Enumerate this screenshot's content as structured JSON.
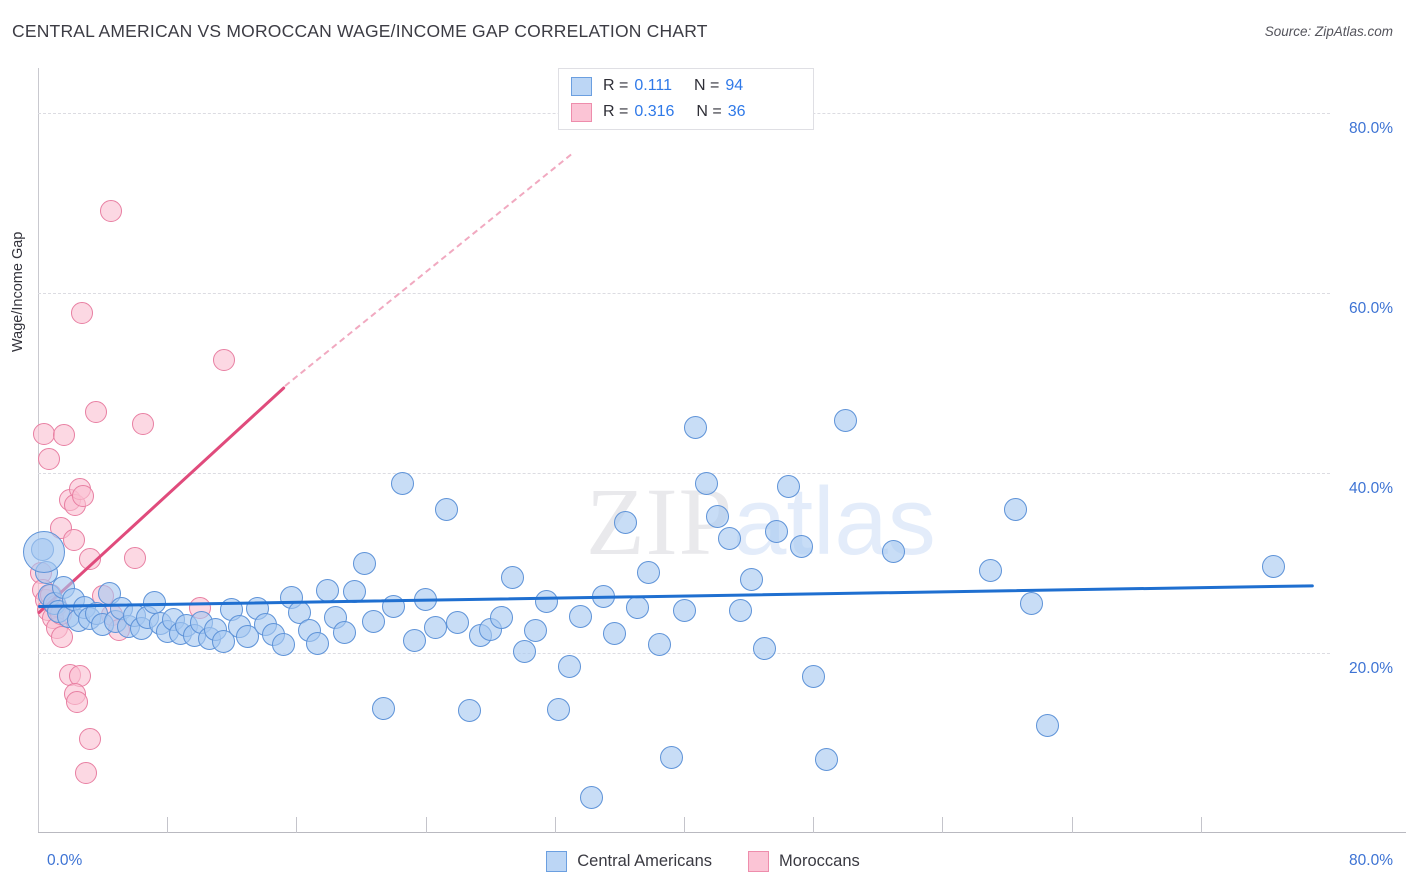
{
  "header": {
    "title": "CENTRAL AMERICAN VS MOROCCAN WAGE/INCOME GAP CORRELATION CHART",
    "source": "Source: ZipAtlas.com"
  },
  "watermark": {
    "part1": "ZIP",
    "part2": "atlas"
  },
  "stats": {
    "rows": [
      {
        "series": "Central Americans",
        "r_label": "R =",
        "r_value": "0.111",
        "n_label": "N =",
        "n_value": "94",
        "color": "#bcd6f5"
      },
      {
        "series": "Moroccans",
        "r_label": "R =",
        "r_value": "0.316",
        "n_label": "N =",
        "n_value": "36",
        "color": "#fbc4d5"
      }
    ]
  },
  "legend": {
    "items": [
      {
        "label": "Central Americans",
        "color": "#bcd6f5"
      },
      {
        "label": "Moroccans",
        "color": "#fbc4d5"
      }
    ]
  },
  "axes": {
    "y_title": "Wage/Income Gap",
    "y_ticks": [
      "80.0%",
      "60.0%",
      "40.0%",
      "20.0%"
    ],
    "x_min_label": "0.0%",
    "x_max_label": "80.0%"
  },
  "chart_data": {
    "type": "scatter",
    "title": "CENTRAL AMERICAN VS MOROCCAN WAGE/INCOME GAP CORRELATION CHART",
    "xlabel": "",
    "ylabel": "Wage/Income Gap",
    "xlim": [
      0,
      80
    ],
    "ylim": [
      0,
      85
    ],
    "x_unit": "%",
    "y_unit": "%",
    "grid": true,
    "y_gridlines": [
      20,
      40,
      60,
      80
    ],
    "legend_position": "bottom-center",
    "series": [
      {
        "name": "Central Americans",
        "color": "#a7c8f0",
        "border_color": "#5e93d8",
        "r": 0.111,
        "n": 94,
        "trendline": {
          "style": "solid",
          "x0": 0.0,
          "y0": 25.3,
          "x1": 79.0,
          "y1": 27.6
        },
        "points": [
          [
            0.3,
            31.5
          ],
          [
            0.5,
            29.0
          ],
          [
            0.7,
            26.4
          ],
          [
            1.0,
            25.5
          ],
          [
            1.3,
            24.6
          ],
          [
            1.6,
            27.3
          ],
          [
            1.9,
            24.1
          ],
          [
            2.2,
            26.0
          ],
          [
            2.5,
            23.6
          ],
          [
            2.9,
            25.1
          ],
          [
            3.2,
            23.8
          ],
          [
            3.6,
            24.4
          ],
          [
            4.0,
            23.2
          ],
          [
            4.4,
            26.6
          ],
          [
            4.8,
            23.5
          ],
          [
            5.2,
            24.9
          ],
          [
            5.6,
            23.0
          ],
          [
            6.0,
            24.2
          ],
          [
            6.4,
            22.7
          ],
          [
            6.8,
            23.9
          ],
          [
            7.2,
            25.6
          ],
          [
            7.6,
            23.3
          ],
          [
            8.0,
            22.4
          ],
          [
            8.4,
            23.7
          ],
          [
            8.8,
            22.2
          ],
          [
            9.2,
            23.1
          ],
          [
            9.7,
            22.0
          ],
          [
            10.1,
            23.4
          ],
          [
            10.6,
            21.6
          ],
          [
            11.0,
            22.6
          ],
          [
            11.5,
            21.3
          ],
          [
            12.0,
            24.8
          ],
          [
            12.5,
            22.9
          ],
          [
            13.0,
            21.8
          ],
          [
            13.6,
            25.0
          ],
          [
            14.1,
            23.2
          ],
          [
            14.6,
            22.1
          ],
          [
            15.2,
            21.0
          ],
          [
            15.7,
            26.2
          ],
          [
            16.2,
            24.5
          ],
          [
            16.8,
            22.5
          ],
          [
            17.3,
            21.1
          ],
          [
            17.9,
            27.0
          ],
          [
            18.4,
            24.0
          ],
          [
            19.0,
            22.3
          ],
          [
            19.6,
            26.8
          ],
          [
            20.2,
            30.0
          ],
          [
            20.8,
            23.5
          ],
          [
            21.4,
            13.8
          ],
          [
            22.0,
            25.2
          ],
          [
            22.6,
            38.8
          ],
          [
            23.3,
            21.4
          ],
          [
            24.0,
            25.9
          ],
          [
            24.6,
            22.8
          ],
          [
            25.3,
            36.0
          ],
          [
            26.0,
            23.4
          ],
          [
            26.7,
            13.6
          ],
          [
            27.4,
            21.9
          ],
          [
            28.0,
            22.6
          ],
          [
            28.7,
            24.0
          ],
          [
            29.4,
            28.4
          ],
          [
            30.1,
            20.2
          ],
          [
            30.8,
            22.5
          ],
          [
            31.5,
            25.7
          ],
          [
            32.2,
            13.7
          ],
          [
            32.9,
            18.5
          ],
          [
            33.6,
            24.1
          ],
          [
            34.3,
            3.9
          ],
          [
            35.0,
            26.3
          ],
          [
            35.7,
            22.2
          ],
          [
            36.4,
            34.5
          ],
          [
            37.1,
            25.1
          ],
          [
            37.8,
            29.0
          ],
          [
            38.5,
            21.0
          ],
          [
            39.2,
            8.4
          ],
          [
            40.0,
            24.7
          ],
          [
            40.7,
            45.1
          ],
          [
            41.4,
            38.8
          ],
          [
            42.1,
            35.2
          ],
          [
            42.8,
            32.7
          ],
          [
            43.5,
            24.7
          ],
          [
            44.2,
            28.2
          ],
          [
            45.0,
            20.5
          ],
          [
            45.7,
            33.5
          ],
          [
            46.5,
            38.5
          ],
          [
            47.3,
            31.8
          ],
          [
            48.0,
            17.4
          ],
          [
            48.8,
            8.2
          ],
          [
            50.0,
            45.8
          ],
          [
            53.0,
            31.3
          ],
          [
            59.0,
            29.2
          ],
          [
            60.5,
            36.0
          ],
          [
            61.5,
            25.5
          ],
          [
            62.5,
            12.0
          ],
          [
            76.5,
            29.6
          ]
        ]
      },
      {
        "name": "Moroccans",
        "color": "#fabed0",
        "border_color": "#e87fa2",
        "r": 0.316,
        "n": 36,
        "trendline": {
          "style": "solid-then-dashed",
          "x0": 0.0,
          "y0": 24.6,
          "x1": 15.3,
          "y1": 49.8,
          "dash_x1": 33.0,
          "dash_y1": 75.5
        },
        "points": [
          [
            0.2,
            28.9
          ],
          [
            0.3,
            27.0
          ],
          [
            0.5,
            25.9
          ],
          [
            0.6,
            24.8
          ],
          [
            0.8,
            26.5
          ],
          [
            0.9,
            23.9
          ],
          [
            1.1,
            25.2
          ],
          [
            1.2,
            22.8
          ],
          [
            1.4,
            24.3
          ],
          [
            1.5,
            21.8
          ],
          [
            0.4,
            44.3
          ],
          [
            0.7,
            41.6
          ],
          [
            1.6,
            44.2
          ],
          [
            2.0,
            37.0
          ],
          [
            2.3,
            36.4
          ],
          [
            2.6,
            38.2
          ],
          [
            2.8,
            37.4
          ],
          [
            1.4,
            33.9
          ],
          [
            2.2,
            32.6
          ],
          [
            3.2,
            30.5
          ],
          [
            3.6,
            46.8
          ],
          [
            2.7,
            57.8
          ],
          [
            4.5,
            69.1
          ],
          [
            6.5,
            45.5
          ],
          [
            6.0,
            30.6
          ],
          [
            4.0,
            26.3
          ],
          [
            4.6,
            24.2
          ],
          [
            5.0,
            22.6
          ],
          [
            2.0,
            17.6
          ],
          [
            2.6,
            17.5
          ],
          [
            2.3,
            15.4
          ],
          [
            2.4,
            14.6
          ],
          [
            3.2,
            10.5
          ],
          [
            3.0,
            6.7
          ],
          [
            11.5,
            52.6
          ],
          [
            10.0,
            25.0
          ]
        ]
      }
    ]
  }
}
